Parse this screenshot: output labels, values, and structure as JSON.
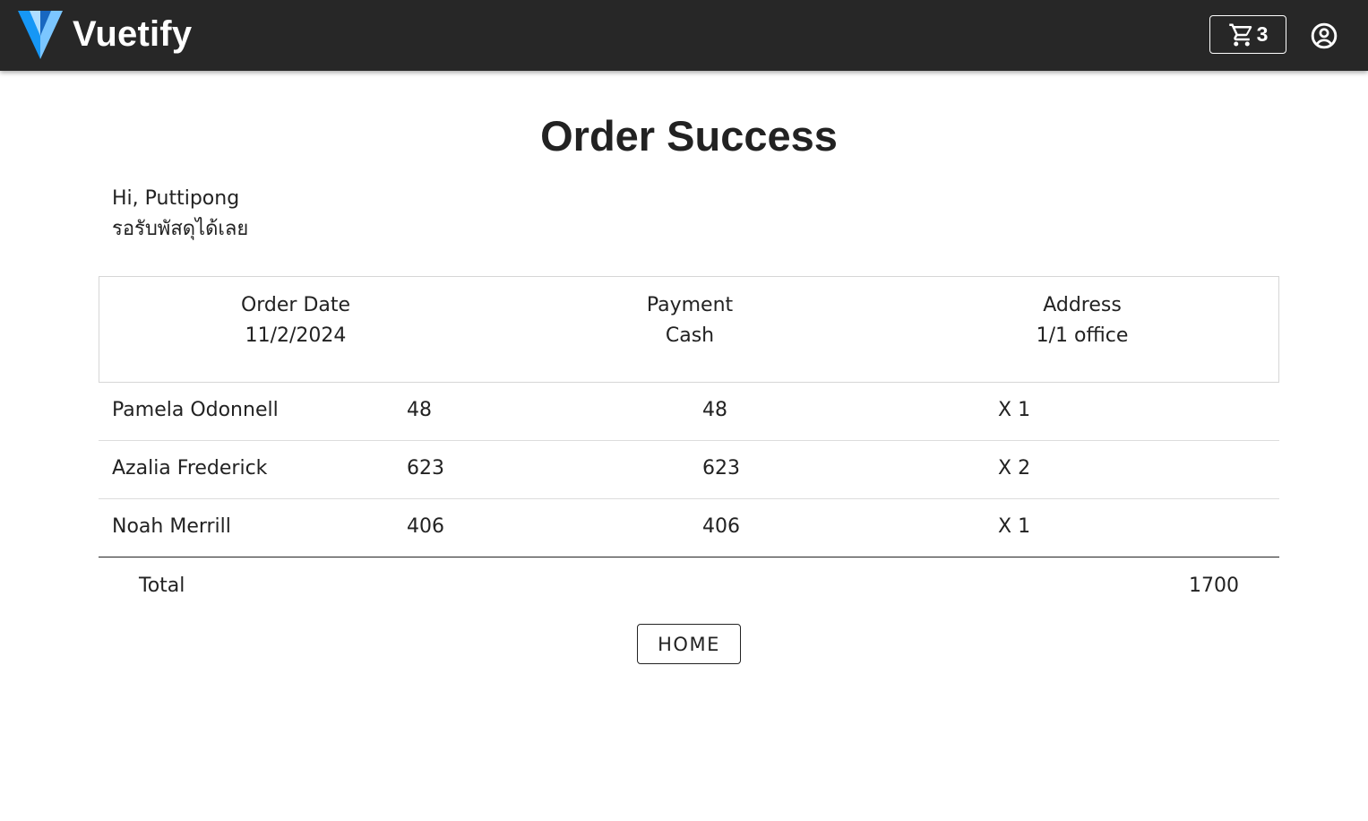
{
  "app_bar": {
    "brand": "Vuetify",
    "logo_icon": "vuetify-logo",
    "cart_icon": "cart-icon",
    "cart_count": "3",
    "account_icon": "account-circle-icon",
    "background": "#272727"
  },
  "page": {
    "title": "Order Success",
    "greeting": "Hi, Puttipong",
    "message": "รอรับพัสดุได้เลย"
  },
  "order_info": {
    "order_date_label": "Order Date",
    "order_date_value": "11/2/2024",
    "payment_label": "Payment",
    "payment_value": "Cash",
    "address_label": "Address",
    "address_value": "1/1 office"
  },
  "items": [
    {
      "name": "Pamela Odonnell",
      "price": "48",
      "subtotal": "48",
      "qty": "X 1"
    },
    {
      "name": "Azalia Frederick",
      "price": "623",
      "subtotal": "623",
      "qty": "X 2"
    },
    {
      "name": "Noah Merrill",
      "price": "406",
      "subtotal": "406",
      "qty": "X 1"
    }
  ],
  "total": {
    "label": "Total",
    "value": "1700"
  },
  "home_button": {
    "label": "HOME"
  }
}
